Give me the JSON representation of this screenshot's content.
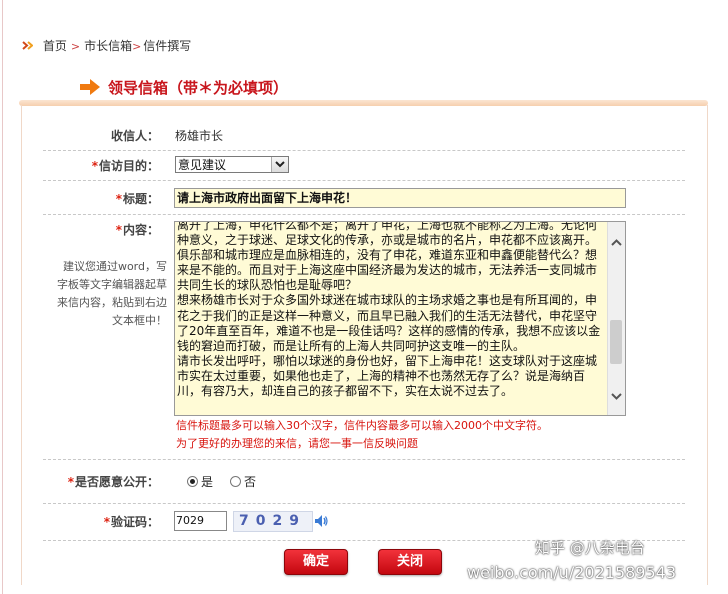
{
  "breadcrumb": {
    "items": [
      "首页",
      "市长信箱",
      "信件撰写"
    ]
  },
  "panel": {
    "title": "领导信箱（带＊为必填项）"
  },
  "form": {
    "recipient": {
      "label": "收信人：",
      "value": "杨雄市长"
    },
    "purpose": {
      "label": "信访目的：",
      "selected": "意见建议"
    },
    "subject": {
      "label": "标题：",
      "value": "请上海市政府出面留下上海申花！"
    },
    "content": {
      "label": "内容：",
      "hint": "建议您通过word，写字板等文字编辑器起草来信内容，粘贴到右边文本框中！",
      "value": "离开了上海，申花什么都不是；离开了申花，上海也就不能称之为上海。无论何种意义，之于球迷、足球文化的传承，亦或是城市的名片，申花都不应该离开。俱乐部和城市理应是血脉相连的，没有了申花，难道东亚和申鑫便能替代么？想来是不能的。而且对于上海这座中国经济最为发达的城市，无法养活一支同城市共同生长的球队恐怕也是耻辱吧？\n想来杨雄市长对于众多国外球迷在城市球队的主场求婚之事也是有所耳闻的，申花之于我们的正是这样一种意义，而且早已融入我们的生活无法替代，申花坚守了20年直至百年，难道不也是一段佳话吗？这样的感情的传承，我想不应该以金钱的窘迫而打破，而是让所有的上海人共同呵护这支唯一的主队。\n请市长发出呼吁，哪怕以球迷的身份也好，留下上海申花！这支球队对于这座城市实在太过重要，如果他也走了，上海的精神不也荡然无存了么？说是海纳百川，有容乃大，却连自己的孩子都留不下，实在太说不过去了。"
    },
    "limit_note": "信件标题最多可以输入30个汉字，信件内容最多可以输入2000个中文字符。",
    "one_matter_note": "为了更好的办理您的来信，请您一事一信反映问题",
    "public": {
      "label": "是否愿意公开：",
      "yes": "是",
      "no": "否",
      "selected": "是"
    },
    "captcha": {
      "label": "验证码：",
      "value": "7029",
      "image_text": "7029"
    }
  },
  "buttons": {
    "confirm": "确定",
    "close": "关闭"
  },
  "watermarks": {
    "zhihu": "知乎 @八杂电台",
    "weibo": "weibo.com/u/2021589543"
  },
  "colors": {
    "accent": "#c8161d",
    "button": "#d81c24",
    "input_bg": "#fffbd6"
  }
}
